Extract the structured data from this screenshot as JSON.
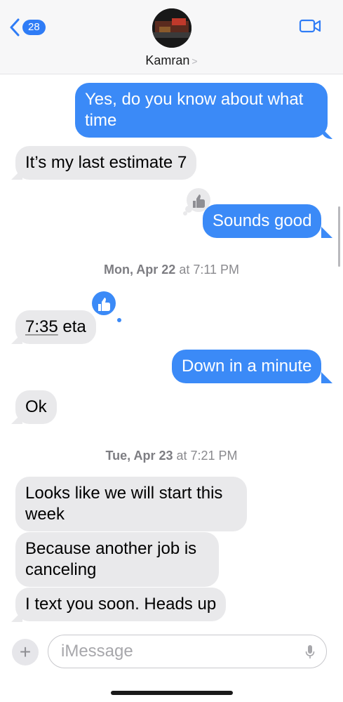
{
  "header": {
    "back_count": "28",
    "contact_name": "Kamran",
    "contact_chevron": ">",
    "video_icon": "video-camera-icon",
    "avatar": "contact-avatar-photo"
  },
  "messages": [
    {
      "side": "out",
      "text": "Yes, do you know about what time"
    },
    {
      "side": "in",
      "text": "It’s my last estimate 7"
    },
    {
      "side": "out",
      "text": "Sounds good",
      "tapback": "thumbs-up"
    },
    {
      "side": "in",
      "text_underlined": "7:35",
      "text_rest": " eta",
      "tapback": "thumbs-up"
    },
    {
      "side": "out",
      "text": "Down in a minute"
    },
    {
      "side": "in",
      "text": "Ok"
    },
    {
      "side": "in",
      "text": "Looks like we will start this week"
    },
    {
      "side": "in",
      "text": "Because another job is canceling"
    },
    {
      "side": "in",
      "text": "I text you soon. Heads up"
    }
  ],
  "timestamps": [
    {
      "day": "Mon, Apr 22",
      "time": " at 7:11 PM"
    },
    {
      "day": "Tue, Apr 23",
      "time": " at 7:21 PM"
    }
  ],
  "composer": {
    "plus": "+",
    "placeholder": "iMessage"
  },
  "colors": {
    "outgoing": "#3b8af7",
    "incoming": "#e9e9eb",
    "accent": "#2f7cf6"
  }
}
